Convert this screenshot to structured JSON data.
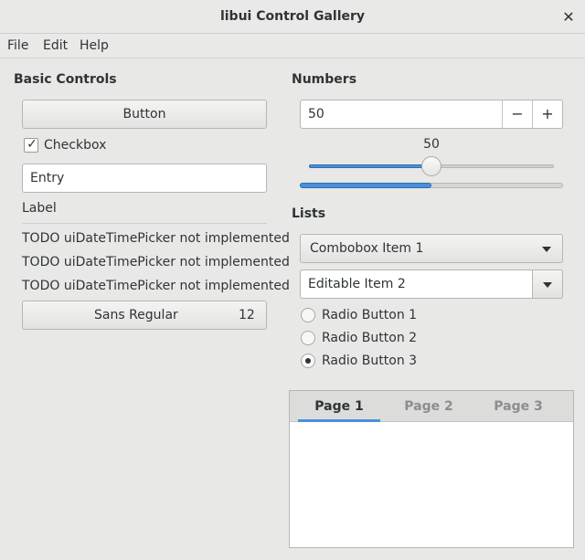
{
  "window": {
    "title": "libui Control Gallery",
    "close_glyph": "✕",
    "close_icon": "close-icon"
  },
  "menu": [
    "File",
    "Edit",
    "Help"
  ],
  "basic": {
    "heading": "Basic Controls",
    "button_label": "Button",
    "checkbox_label": "Checkbox",
    "checkbox_checked": true,
    "checkbox_glyph": "✓",
    "entry_value": "Entry",
    "label_text": "Label",
    "todo_lines": [
      "TODO uiDateTimePicker not implemented",
      "TODO uiDateTimePicker not implemented",
      "TODO uiDateTimePicker not implemented"
    ],
    "font_button": {
      "name": "Sans Regular",
      "size": "12"
    }
  },
  "numbers": {
    "heading": "Numbers",
    "spinbox_value": "50",
    "minus_glyph": "−",
    "plus_glyph": "+",
    "slider_value": "50",
    "slider_fraction": 0.5,
    "progress_fraction": 0.5
  },
  "lists": {
    "heading": "Lists",
    "combobox_selected": "Combobox Item 1",
    "editable_combobox_value": "Editable Item 2",
    "radios": [
      {
        "label": "Radio Button 1",
        "selected": false
      },
      {
        "label": "Radio Button 2",
        "selected": false
      },
      {
        "label": "Radio Button 3",
        "selected": true
      }
    ]
  },
  "tabs": {
    "items": [
      "Page 1",
      "Page 2",
      "Page 3"
    ],
    "active_index": 0
  },
  "colors": {
    "accent": "#4a90d9",
    "window_bg": "#e8e8e7",
    "text": "#2e3436",
    "inactive_tab_text": "#8a8d8f"
  }
}
